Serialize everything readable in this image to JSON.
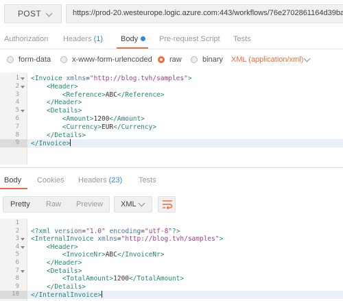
{
  "request": {
    "method": "POST",
    "url": "https://prod-20.westeurope.logic.azure.com:443/workflows/76e2702861164d39ba217f",
    "tabs": [
      {
        "label": "Authorization"
      },
      {
        "label": "Headers",
        "count": "(1)"
      },
      {
        "label": "Body",
        "active": true
      },
      {
        "label": "Pre-request Script"
      },
      {
        "label": "Tests"
      }
    ],
    "body_types": [
      {
        "label": "form-data"
      },
      {
        "label": "x-www-form-urlencoded"
      },
      {
        "label": "raw",
        "selected": true
      },
      {
        "label": "binary"
      }
    ],
    "format": "XML (application/xml)",
    "editor_lines": [
      "<Invoice xmlns=\"http://blog.tvh/samples\">",
      "    <Header>",
      "        <Reference>ABC</Reference>",
      "    </Header>",
      "    <Details>",
      "        <Amount>1200</Amount>",
      "        <Currency>EUR</Currency>",
      "    </Details>",
      "</Invoice>"
    ]
  },
  "response": {
    "tabs": [
      {
        "label": "Body",
        "active": true
      },
      {
        "label": "Cookies"
      },
      {
        "label": "Headers",
        "count": "(23)"
      },
      {
        "label": "Tests"
      }
    ],
    "views": [
      "Pretty",
      "Raw",
      "Preview"
    ],
    "format": "XML",
    "editor_lines": [
      "",
      "<?xml version=\"1.0\" encoding=\"utf-8\"?>",
      "<InternalInvoice xmlns=\"http://blog.tvh/samples\">",
      "    <Header>",
      "        <InvoiceNr>ABC</InvoiceNr>",
      "    </Header>",
      "    <Details>",
      "        <TotalAmount>1200</TotalAmount>",
      "    </Details>",
      "</InternalInvoice>"
    ]
  },
  "colors": {
    "accent": "#f26b3a",
    "count_blue": "#2a8ce0",
    "xml_tag": "#1f8a6e",
    "xml_attr": "#4a74a8",
    "xml_value": "#a03c8c"
  },
  "icons": {
    "method_dropdown": "chevron-down-icon",
    "format_dropdown": "chevron-down-icon",
    "wrap": "wrap-lines-icon"
  }
}
